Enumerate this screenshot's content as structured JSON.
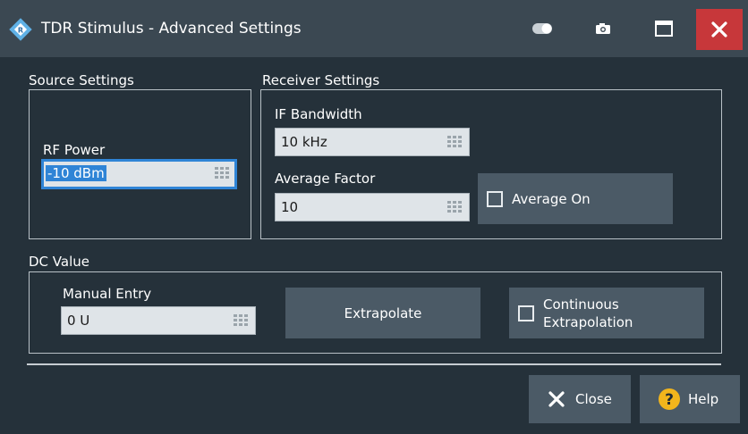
{
  "window": {
    "title": "TDR Stimulus - Advanced Settings",
    "accent_color": "#2f84d6",
    "close_color": "#c7373a"
  },
  "titlebar_icons": [
    "app-logo-icon",
    "toggle-icon",
    "camera-icon",
    "maximize-icon",
    "close-icon"
  ],
  "source_settings": {
    "label": "Source Settings",
    "rf_power": {
      "label": "RF Power",
      "value": "-10 dBm"
    }
  },
  "receiver_settings": {
    "label": "Receiver Settings",
    "if_bandwidth": {
      "label": "IF Bandwidth",
      "value": "10 kHz"
    },
    "average_factor": {
      "label": "Average Factor",
      "value": "10"
    },
    "average_on": {
      "label": "Average On",
      "checked": false
    }
  },
  "dc_value": {
    "label": "DC Value",
    "manual_entry": {
      "label": "Manual Entry",
      "value": "0 U"
    },
    "extrapolate_label": "Extrapolate",
    "continuous": {
      "label_line1": "Continuous",
      "label_line2": "Extrapolation",
      "checked": false
    }
  },
  "footer": {
    "close_label": "Close",
    "help_label": "Help"
  }
}
